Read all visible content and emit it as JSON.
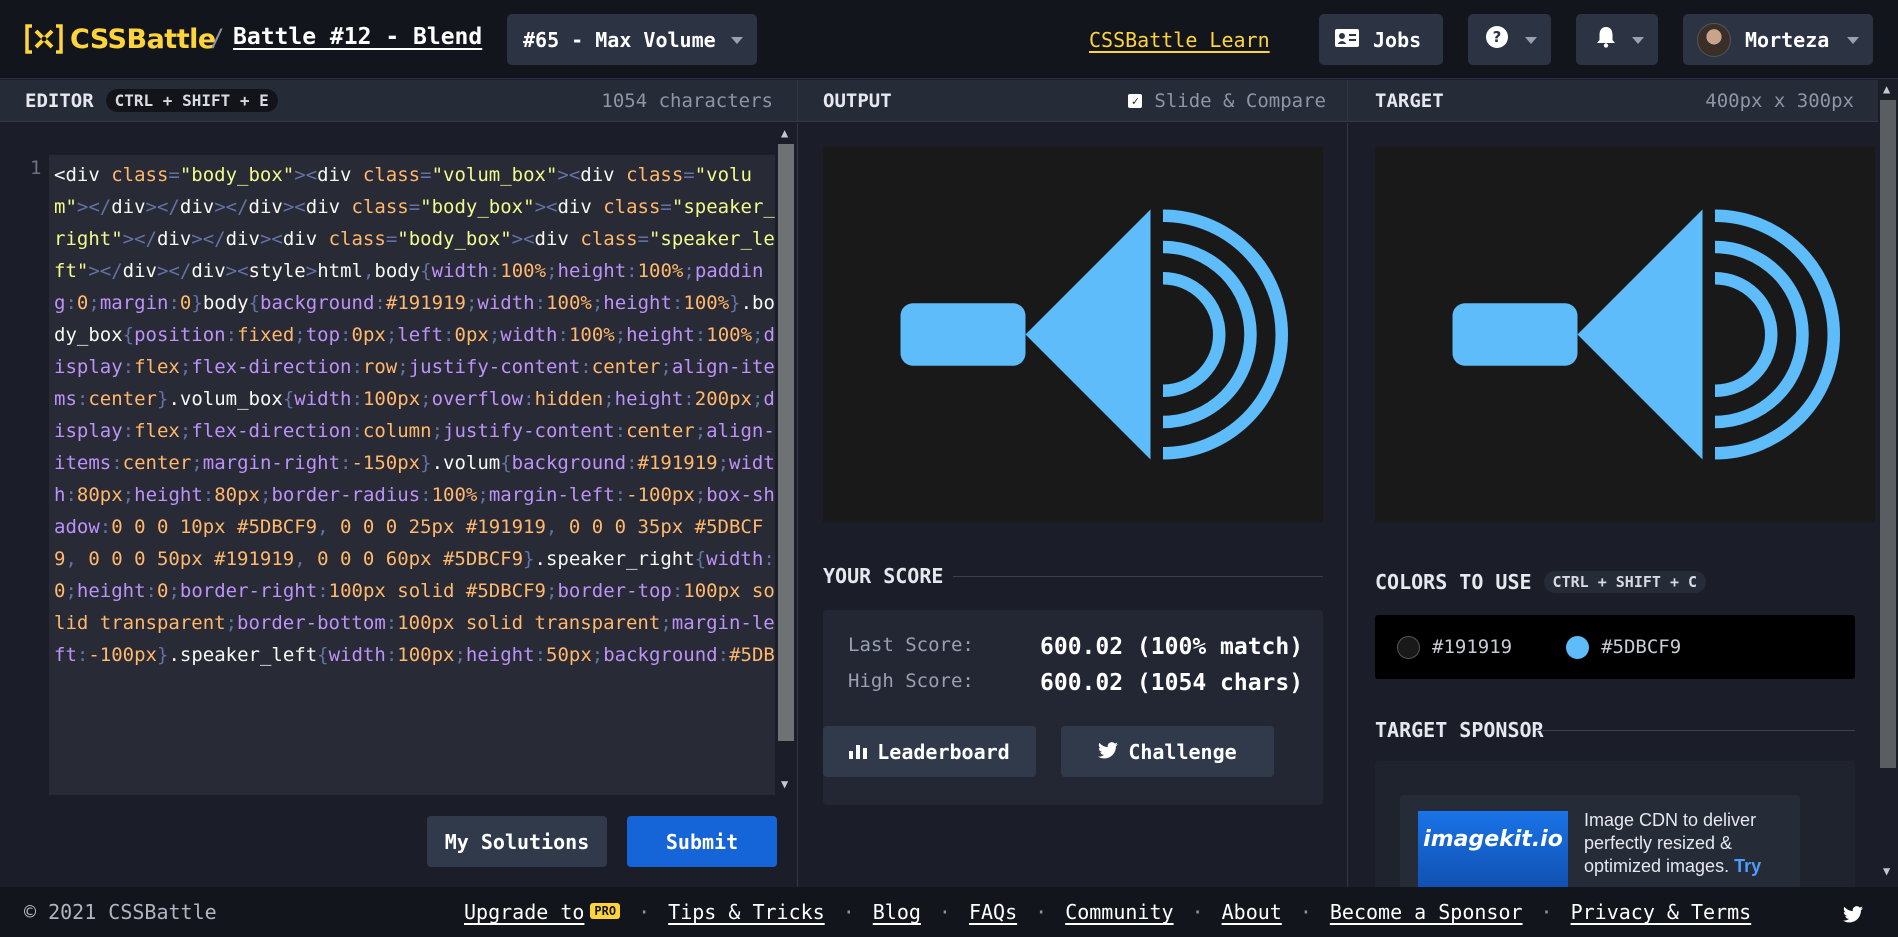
{
  "header": {
    "logo_text": "CSSBattle",
    "crumb_separator": "/",
    "battle_title": "Battle #12 - Blend",
    "target_select": "#65 - Max Volume",
    "learn_link": "CSSBattle Learn",
    "jobs_label": "Jobs",
    "user_name": "Morteza"
  },
  "editor": {
    "title": "EDITOR",
    "shortcut": "CTRL + SHIFT + E",
    "char_count": "1054 characters",
    "line_number": "1",
    "code_segments": [
      {
        "c": "t",
        "s": "<div "
      },
      {
        "c": "a",
        "s": "class"
      },
      {
        "c": "p",
        "s": "="
      },
      {
        "c": "s",
        "s": "\"body_box\""
      },
      {
        "c": "p",
        "s": "><"
      },
      {
        "c": "t",
        "s": "div "
      },
      {
        "c": "a",
        "s": "class"
      },
      {
        "c": "p",
        "s": "="
      },
      {
        "c": "s",
        "s": "\"volum_box\""
      },
      {
        "c": "p",
        "s": "><"
      },
      {
        "c": "t",
        "s": "div "
      },
      {
        "c": "a",
        "s": "class"
      },
      {
        "c": "p",
        "s": "="
      },
      {
        "c": "s",
        "s": "\"volum\""
      },
      {
        "c": "p",
        "s": "></"
      },
      {
        "c": "t",
        "s": "div"
      },
      {
        "c": "p",
        "s": "></"
      },
      {
        "c": "t",
        "s": "div"
      },
      {
        "c": "p",
        "s": "></"
      },
      {
        "c": "t",
        "s": "div"
      },
      {
        "c": "p",
        "s": "><"
      },
      {
        "c": "t",
        "s": "div "
      },
      {
        "c": "a",
        "s": "class"
      },
      {
        "c": "p",
        "s": "="
      },
      {
        "c": "s",
        "s": "\"body_box\""
      },
      {
        "c": "p",
        "s": "><"
      },
      {
        "c": "t",
        "s": "div "
      },
      {
        "c": "a",
        "s": "class"
      },
      {
        "c": "p",
        "s": "="
      },
      {
        "c": "s",
        "s": "\"speaker_right\""
      },
      {
        "c": "p",
        "s": "></"
      },
      {
        "c": "t",
        "s": "div"
      },
      {
        "c": "p",
        "s": "></"
      },
      {
        "c": "t",
        "s": "div"
      },
      {
        "c": "p",
        "s": "><"
      },
      {
        "c": "t",
        "s": "div "
      },
      {
        "c": "a",
        "s": "class"
      },
      {
        "c": "p",
        "s": "="
      },
      {
        "c": "s",
        "s": "\"body_box\""
      },
      {
        "c": "p",
        "s": "><"
      },
      {
        "c": "t",
        "s": "div "
      },
      {
        "c": "a",
        "s": "class"
      },
      {
        "c": "p",
        "s": "="
      },
      {
        "c": "s",
        "s": "\"speaker_left\""
      },
      {
        "c": "p",
        "s": "></"
      },
      {
        "c": "t",
        "s": "div"
      },
      {
        "c": "p",
        "s": "></"
      },
      {
        "c": "t",
        "s": "div"
      },
      {
        "c": "p",
        "s": ">"
      },
      {
        "c": "p",
        "s": "<"
      },
      {
        "c": "t",
        "s": "style"
      },
      {
        "c": "p",
        "s": ">"
      },
      {
        "c": "t",
        "s": "html"
      },
      {
        "c": "p",
        "s": ","
      },
      {
        "c": "t",
        "s": "body"
      },
      {
        "c": "p",
        "s": "{"
      },
      {
        "c": "k",
        "s": "width"
      },
      {
        "c": "p",
        "s": ":"
      },
      {
        "c": "v",
        "s": "100%"
      },
      {
        "c": "p",
        "s": ";"
      },
      {
        "c": "k",
        "s": "height"
      },
      {
        "c": "p",
        "s": ":"
      },
      {
        "c": "v",
        "s": "100%"
      },
      {
        "c": "p",
        "s": ";"
      },
      {
        "c": "k",
        "s": "padding"
      },
      {
        "c": "p",
        "s": ":"
      },
      {
        "c": "v",
        "s": "0"
      },
      {
        "c": "p",
        "s": ";"
      },
      {
        "c": "k",
        "s": "margin"
      },
      {
        "c": "p",
        "s": ":"
      },
      {
        "c": "v",
        "s": "0"
      },
      {
        "c": "p",
        "s": "}"
      },
      {
        "c": "t",
        "s": "body"
      },
      {
        "c": "p",
        "s": "{"
      },
      {
        "c": "k",
        "s": "background"
      },
      {
        "c": "p",
        "s": ":"
      },
      {
        "c": "v",
        "s": "#191919"
      },
      {
        "c": "p",
        "s": ";"
      },
      {
        "c": "k",
        "s": "width"
      },
      {
        "c": "p",
        "s": ":"
      },
      {
        "c": "v",
        "s": "100%"
      },
      {
        "c": "p",
        "s": ";"
      },
      {
        "c": "k",
        "s": "height"
      },
      {
        "c": "p",
        "s": ":"
      },
      {
        "c": "v",
        "s": "100%"
      },
      {
        "c": "p",
        "s": "}"
      },
      {
        "c": "t",
        "s": ".body_box"
      },
      {
        "c": "p",
        "s": "{"
      },
      {
        "c": "k",
        "s": "position"
      },
      {
        "c": "p",
        "s": ":"
      },
      {
        "c": "v",
        "s": "fixed"
      },
      {
        "c": "p",
        "s": ";"
      },
      {
        "c": "k",
        "s": "top"
      },
      {
        "c": "p",
        "s": ":"
      },
      {
        "c": "v",
        "s": "0px"
      },
      {
        "c": "p",
        "s": ";"
      },
      {
        "c": "k",
        "s": "left"
      },
      {
        "c": "p",
        "s": ":"
      },
      {
        "c": "v",
        "s": "0px"
      },
      {
        "c": "p",
        "s": ";"
      },
      {
        "c": "k",
        "s": "width"
      },
      {
        "c": "p",
        "s": ":"
      },
      {
        "c": "v",
        "s": "100%"
      },
      {
        "c": "p",
        "s": ";"
      },
      {
        "c": "k",
        "s": "height"
      },
      {
        "c": "p",
        "s": ":"
      },
      {
        "c": "v",
        "s": "100%"
      },
      {
        "c": "p",
        "s": ";"
      },
      {
        "c": "k",
        "s": "display"
      },
      {
        "c": "p",
        "s": ":"
      },
      {
        "c": "v",
        "s": "flex"
      },
      {
        "c": "p",
        "s": ";"
      },
      {
        "c": "k",
        "s": "flex-direction"
      },
      {
        "c": "p",
        "s": ":"
      },
      {
        "c": "v",
        "s": "row"
      },
      {
        "c": "p",
        "s": ";"
      },
      {
        "c": "k",
        "s": "justify-content"
      },
      {
        "c": "p",
        "s": ":"
      },
      {
        "c": "v",
        "s": "center"
      },
      {
        "c": "p",
        "s": ";"
      },
      {
        "c": "k",
        "s": "align-items"
      },
      {
        "c": "p",
        "s": ":"
      },
      {
        "c": "v",
        "s": "center"
      },
      {
        "c": "p",
        "s": "}"
      },
      {
        "c": "t",
        "s": ".volum_box"
      },
      {
        "c": "p",
        "s": "{"
      },
      {
        "c": "k",
        "s": "width"
      },
      {
        "c": "p",
        "s": ":"
      },
      {
        "c": "v",
        "s": "100px"
      },
      {
        "c": "p",
        "s": ";"
      },
      {
        "c": "k",
        "s": "overflow"
      },
      {
        "c": "p",
        "s": ":"
      },
      {
        "c": "v",
        "s": "hidden"
      },
      {
        "c": "p",
        "s": ";"
      },
      {
        "c": "k",
        "s": "height"
      },
      {
        "c": "p",
        "s": ":"
      },
      {
        "c": "v",
        "s": "200px"
      },
      {
        "c": "p",
        "s": ";"
      },
      {
        "c": "k",
        "s": "display"
      },
      {
        "c": "p",
        "s": ":"
      },
      {
        "c": "v",
        "s": "flex"
      },
      {
        "c": "p",
        "s": ";"
      },
      {
        "c": "k",
        "s": "flex-direction"
      },
      {
        "c": "p",
        "s": ":"
      },
      {
        "c": "v",
        "s": "column"
      },
      {
        "c": "p",
        "s": ";"
      },
      {
        "c": "k",
        "s": "justify-content"
      },
      {
        "c": "p",
        "s": ":"
      },
      {
        "c": "v",
        "s": "center"
      },
      {
        "c": "p",
        "s": ";"
      },
      {
        "c": "k",
        "s": "align-items"
      },
      {
        "c": "p",
        "s": ":"
      },
      {
        "c": "v",
        "s": "center"
      },
      {
        "c": "p",
        "s": ";"
      },
      {
        "c": "k",
        "s": "margin-right"
      },
      {
        "c": "p",
        "s": ":"
      },
      {
        "c": "v",
        "s": "-150px"
      },
      {
        "c": "p",
        "s": "}"
      },
      {
        "c": "t",
        "s": ".volum"
      },
      {
        "c": "p",
        "s": "{"
      },
      {
        "c": "k",
        "s": "background"
      },
      {
        "c": "p",
        "s": ":"
      },
      {
        "c": "v",
        "s": "#191919"
      },
      {
        "c": "p",
        "s": ";"
      },
      {
        "c": "k",
        "s": "width"
      },
      {
        "c": "p",
        "s": ":"
      },
      {
        "c": "v",
        "s": "80px"
      },
      {
        "c": "p",
        "s": ";"
      },
      {
        "c": "k",
        "s": "height"
      },
      {
        "c": "p",
        "s": ":"
      },
      {
        "c": "v",
        "s": "80px"
      },
      {
        "c": "p",
        "s": ";"
      },
      {
        "c": "k",
        "s": "border-radius"
      },
      {
        "c": "p",
        "s": ":"
      },
      {
        "c": "v",
        "s": "100%"
      },
      {
        "c": "p",
        "s": ";"
      },
      {
        "c": "k",
        "s": "margin-left"
      },
      {
        "c": "p",
        "s": ":"
      },
      {
        "c": "v",
        "s": "-100px"
      },
      {
        "c": "p",
        "s": ";"
      },
      {
        "c": "k",
        "s": "box-shadow"
      },
      {
        "c": "p",
        "s": ":"
      },
      {
        "c": "v",
        "s": "0 0 0 10px #5DBCF9"
      },
      {
        "c": "p",
        "s": ", "
      },
      {
        "c": "v",
        "s": "0 0 0 25px #191919"
      },
      {
        "c": "p",
        "s": ", "
      },
      {
        "c": "v",
        "s": "0 0 0 35px #5DBCF9"
      },
      {
        "c": "p",
        "s": ", "
      },
      {
        "c": "v",
        "s": "0 0 0 50px #191919"
      },
      {
        "c": "p",
        "s": ", "
      },
      {
        "c": "v",
        "s": "0 0 0 60px #5DBCF9"
      },
      {
        "c": "p",
        "s": "}"
      },
      {
        "c": "t",
        "s": ".speaker_right"
      },
      {
        "c": "p",
        "s": "{"
      },
      {
        "c": "k",
        "s": "width"
      },
      {
        "c": "p",
        "s": ":"
      },
      {
        "c": "v",
        "s": "0"
      },
      {
        "c": "p",
        "s": ";"
      },
      {
        "c": "k",
        "s": "height"
      },
      {
        "c": "p",
        "s": ":"
      },
      {
        "c": "v",
        "s": "0"
      },
      {
        "c": "p",
        "s": ";"
      },
      {
        "c": "k",
        "s": "border-right"
      },
      {
        "c": "p",
        "s": ":"
      },
      {
        "c": "v",
        "s": "100px solid #5DBCF9"
      },
      {
        "c": "p",
        "s": ";"
      },
      {
        "c": "k",
        "s": "border-top"
      },
      {
        "c": "p",
        "s": ":"
      },
      {
        "c": "v",
        "s": "100px solid transparent"
      },
      {
        "c": "p",
        "s": ";"
      },
      {
        "c": "k",
        "s": "border-bottom"
      },
      {
        "c": "p",
        "s": ":"
      },
      {
        "c": "v",
        "s": "100px solid transparent"
      },
      {
        "c": "p",
        "s": ";"
      },
      {
        "c": "k",
        "s": "margin-left"
      },
      {
        "c": "p",
        "s": ":"
      },
      {
        "c": "v",
        "s": "-100px"
      },
      {
        "c": "p",
        "s": "}"
      },
      {
        "c": "t",
        "s": ".speaker_left"
      },
      {
        "c": "p",
        "s": "{"
      },
      {
        "c": "k",
        "s": "width"
      },
      {
        "c": "p",
        "s": ":"
      },
      {
        "c": "v",
        "s": "100px"
      },
      {
        "c": "p",
        "s": ";"
      },
      {
        "c": "k",
        "s": "height"
      },
      {
        "c": "p",
        "s": ":"
      },
      {
        "c": "v",
        "s": "50px"
      },
      {
        "c": "p",
        "s": ";"
      },
      {
        "c": "k",
        "s": "background"
      },
      {
        "c": "p",
        "s": ":"
      },
      {
        "c": "v",
        "s": "#5DB"
      }
    ],
    "my_solutions_label": "My Solutions",
    "submit_label": "Submit"
  },
  "output": {
    "title": "OUTPUT",
    "slide_compare_label": "Slide & Compare",
    "slide_compare_checked": true,
    "your_score_title": "YOUR SCORE",
    "last_score_label": "Last Score:",
    "last_score_value": "600.02 (100% match)",
    "high_score_label": "High Score:",
    "high_score_value": "600.02 (1054 chars)",
    "leaderboard_label": "Leaderboard",
    "challenge_label": "Challenge"
  },
  "target": {
    "title": "TARGET",
    "dimensions": "400px x 300px",
    "colors_title": "COLORS TO USE",
    "colors_shortcut": "CTRL + SHIFT + C",
    "colors": [
      {
        "hex": "#191919",
        "label": "#191919"
      },
      {
        "hex": "#5DBCF9",
        "label": "#5DBCF9"
      }
    ],
    "sponsor_title": "TARGET SPONSOR",
    "sponsor_logo_text": "imagekit.io",
    "sponsor_text": "Image CDN to deliver perfectly resized & optimized images.",
    "sponsor_link": "Try"
  },
  "footer": {
    "copyright": "© 2021 CSSBattle",
    "links": {
      "upgrade": "Upgrade to",
      "pro_badge": "PRO",
      "tips": "Tips & Tricks",
      "blog": "Blog",
      "faqs": "FAQs",
      "community": "Community",
      "about": "About",
      "sponsor": "Become a Sponsor",
      "privacy": "Privacy & Terms"
    },
    "separator": "·"
  },
  "colors": {
    "accent_yellow": "#ffd43b",
    "submit_blue": "#1565d8",
    "canvas_bg": "#191919",
    "speaker_blue": "#5DBCF9"
  }
}
